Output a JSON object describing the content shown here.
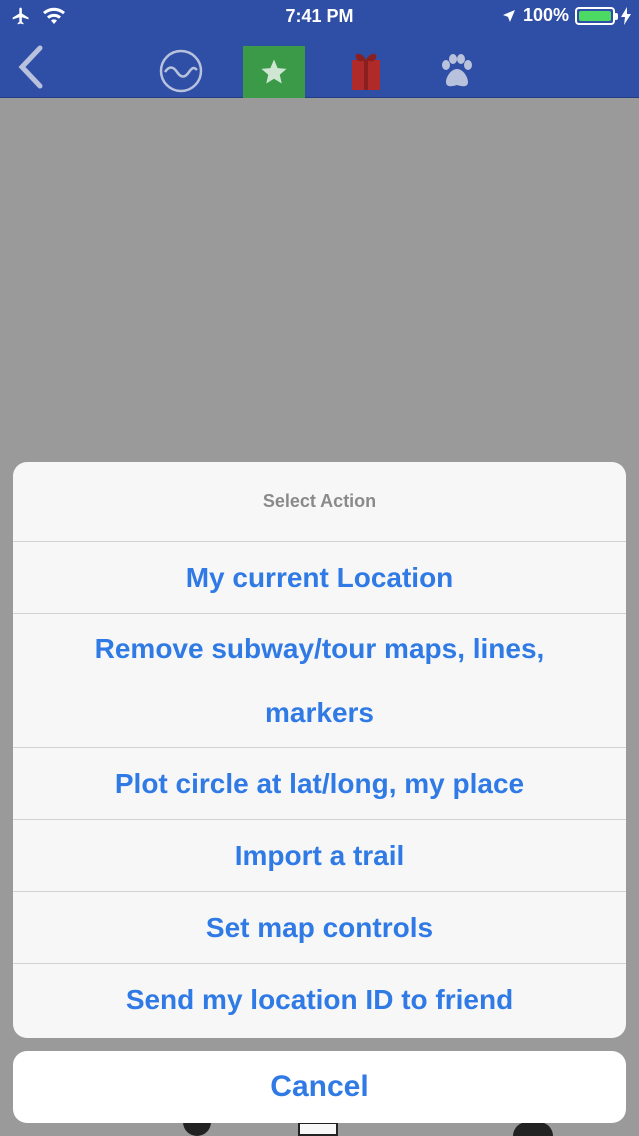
{
  "status_bar": {
    "time": "7:41 PM",
    "battery_text": "100%"
  },
  "nav": {
    "icons": [
      "back-chevron",
      "wave-circle",
      "star",
      "gift",
      "paw"
    ],
    "active_color": "#3a9a48",
    "bar_color": "#2f4fa6"
  },
  "action_sheet": {
    "title": "Select Action",
    "items": [
      "My current Location",
      "Remove subway/tour maps, lines, markers",
      "Plot circle at lat/long, my place",
      "Import a trail",
      "Set map controls",
      "Send my location ID to friend"
    ],
    "cancel_label": "Cancel",
    "accent_color": "#2f7ae5"
  }
}
